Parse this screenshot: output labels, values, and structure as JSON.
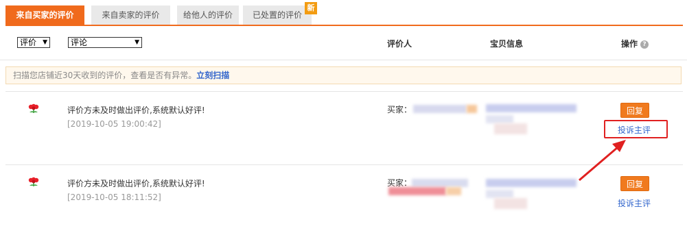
{
  "tabs": [
    {
      "label": "来自买家的评价",
      "active": true
    },
    {
      "label": "来自卖家的评价",
      "active": false
    },
    {
      "label": "给他人的评价",
      "active": false
    },
    {
      "label": "已处置的评价",
      "active": false
    }
  ],
  "new_badge": "新",
  "filters": {
    "rating_label": "评价",
    "comment_label": "评论"
  },
  "columns": {
    "reviewer": "评价人",
    "item_info": "宝贝信息",
    "actions": "操作"
  },
  "notice": {
    "text": "扫描您店铺近30天收到的评价，查看是否有异常。",
    "link": "立刻扫描"
  },
  "reviews": [
    {
      "text": "评价方未及时做出评价,系统默认好评!",
      "time": "[2019-10-05 19:00:42]",
      "buyer_label": "买家：",
      "reply": "回复",
      "complain": "投诉主评"
    },
    {
      "text": "评价方未及时做出评价,系统默认好评!",
      "time": "[2019-10-05 18:11:52]",
      "buyer_label": "买家：",
      "reply": "回复",
      "complain": "投诉主评"
    }
  ],
  "colors": {
    "accent": "#f06a1c",
    "link": "#3366cc",
    "annotation": "#e02020"
  },
  "icons": [
    "flower-icon",
    "help-icon",
    "dropdown-arrow-icon",
    "arrow-annotation-icon"
  ]
}
